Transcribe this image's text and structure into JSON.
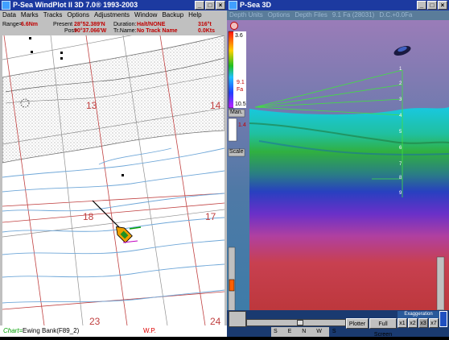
{
  "left_window": {
    "title": "P-Sea WindPlot II 3D 7.0® 1993-2003",
    "menu": [
      "Data",
      "Marks",
      "Tracks",
      "Options",
      "Adjustments",
      "Window",
      "Backup",
      "Help"
    ],
    "info": {
      "range_label": "Range=",
      "range_value": "6.6Nm",
      "present_label": "Present",
      "present_lat": "28°52.389'N",
      "present_lon": "90°37.066'W",
      "pos_label": "Pos>",
      "duration_label": "Duration:",
      "duration_value": "Halt/NONE",
      "trname_label": "Tr.Name:",
      "trname_value": "No Track Name",
      "heading": "316°t",
      "speed": "0.0Kts"
    },
    "chart_labels": [
      "13",
      "14",
      "18",
      "17",
      "23",
      "24"
    ],
    "status": {
      "chart_prefix": "Chart=",
      "chart_name": "Ewing Bank(F89_2)",
      "wp": "W.P."
    }
  },
  "right_window": {
    "title": "P-Sea 3D",
    "menu": [
      "Depth Units",
      "Options",
      "Depth Files",
      "9.1 Fa (28031)",
      "D.C.+0.0Fa"
    ],
    "depth_scale": {
      "max": "3.6",
      "value": "9.1",
      "unit": "Fa",
      "min": "10.5",
      "mode": "Man.",
      "marker_value": "1.4",
      "scale_label": "Scale"
    },
    "probe_ticks": [
      "1",
      "2",
      "3",
      "4",
      "5",
      "6",
      "7",
      "8",
      "9"
    ],
    "bottom": {
      "plotter_btn": "Plotter",
      "fullscreen_btn": "Full Screen",
      "exaggeration_label": "Exaggeration",
      "exag_buttons": [
        "x1",
        "x2",
        "x3",
        "x7"
      ],
      "compass": [
        "S",
        "E",
        "N",
        "W",
        "S"
      ]
    }
  },
  "colors": {
    "title_bar": "#1c3aa0",
    "chart_bg": "#ffffff",
    "warning_red": "#c00000"
  }
}
